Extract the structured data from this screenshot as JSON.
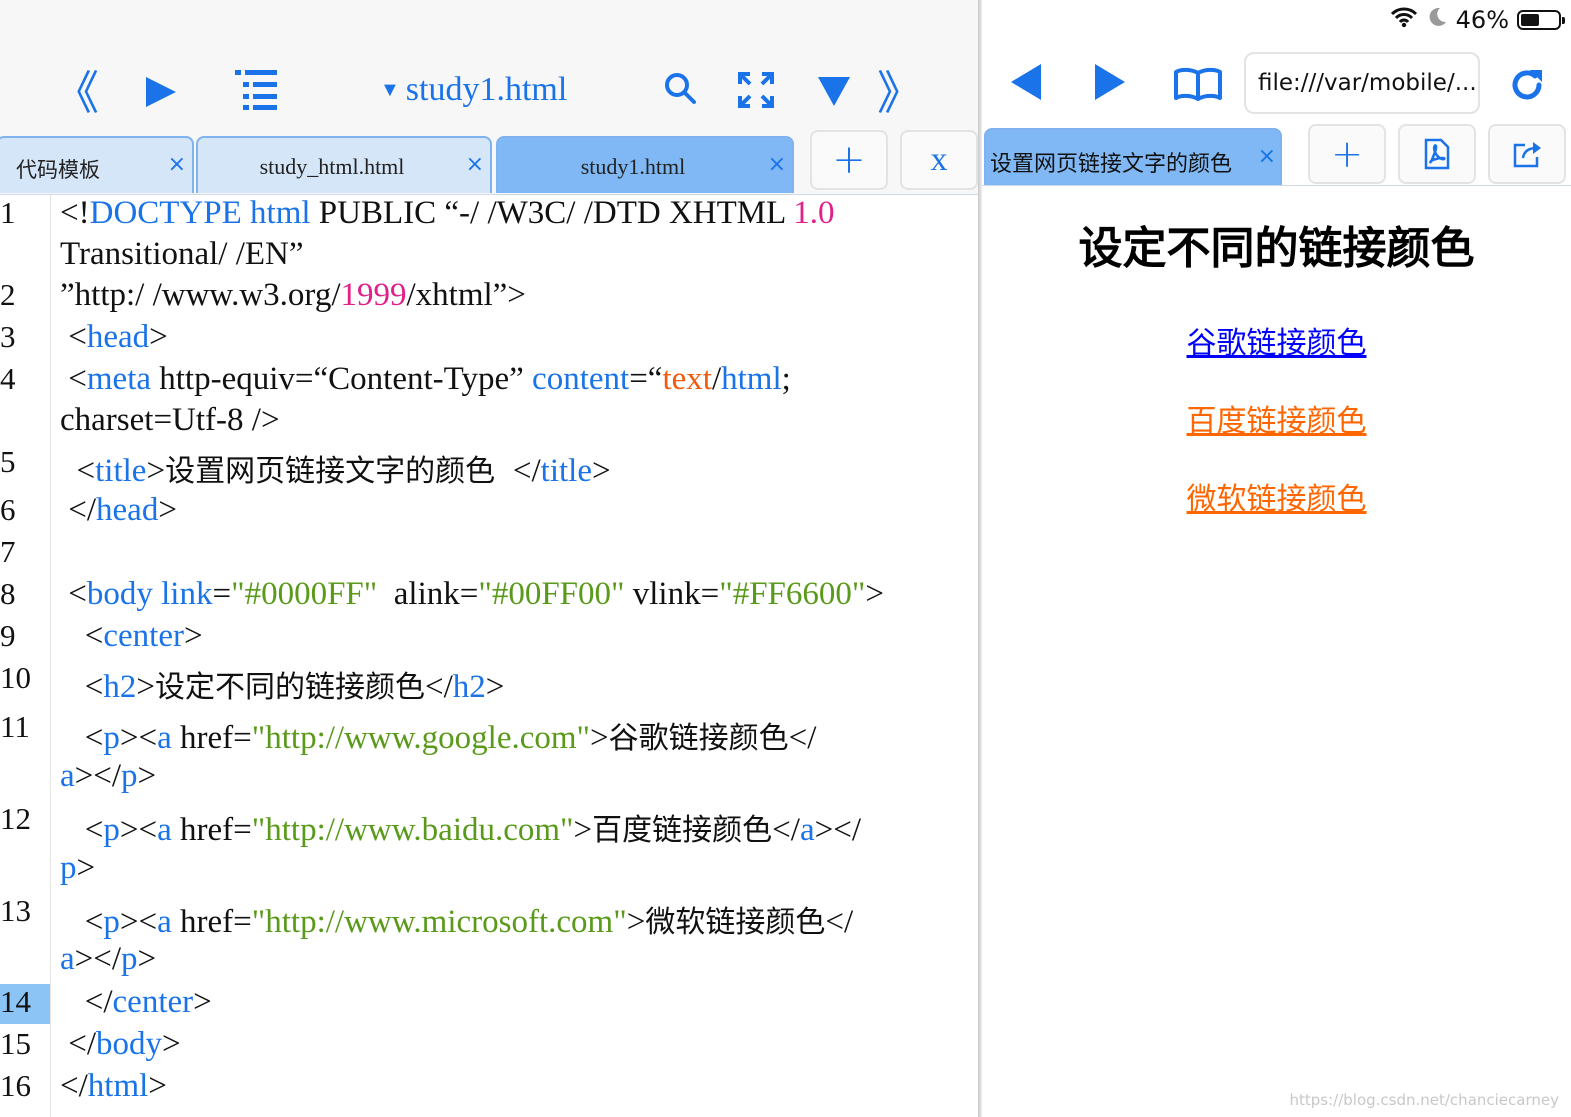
{
  "editor": {
    "file_title": "study1.html",
    "tabs": [
      {
        "label": "代码模板",
        "close": "×"
      },
      {
        "label": "study_html.html",
        "close": "×"
      },
      {
        "label": "study1.html",
        "close": "×",
        "active": true
      }
    ],
    "new_tab": "+",
    "close_all": "x",
    "current_line": 14,
    "line_numbers": [
      "1",
      "2",
      "3",
      "4",
      "5",
      "6",
      "7",
      "8",
      "9",
      "10",
      "11",
      "12",
      "13",
      "14",
      "15",
      "16"
    ]
  },
  "browser": {
    "status": {
      "battery": "46%"
    },
    "url": "file:///var/mobile/...",
    "tab_title": "设置网页链接文字的颜色",
    "tab_close": "×",
    "page": {
      "heading": "设定不同的链接颜色",
      "links": [
        {
          "text": "谷歌链接颜色",
          "color": "#0000FF"
        },
        {
          "text": "百度链接颜色",
          "color": "#FF6600"
        },
        {
          "text": "微软链接颜色",
          "color": "#FF6600"
        }
      ]
    },
    "watermark": "https://blog.csdn.net/chanciecarney"
  },
  "colors": {
    "accent": "#1a73e8",
    "tag": "#1a73e8",
    "number": "#e0218a",
    "string": "#5a9a1a",
    "keyword_orange": "#f15a0c",
    "active_tab": "#7fb8f4"
  },
  "icons": [
    "prev-file-icon",
    "run-icon",
    "outline-icon",
    "search-icon",
    "fullscreen-icon",
    "dropdown-icon",
    "next-file-icon",
    "back-icon",
    "forward-icon",
    "bookmarks-icon",
    "reload-icon",
    "pdf-icon",
    "share-icon",
    "wifi-icon",
    "moon-icon",
    "battery-icon"
  ]
}
